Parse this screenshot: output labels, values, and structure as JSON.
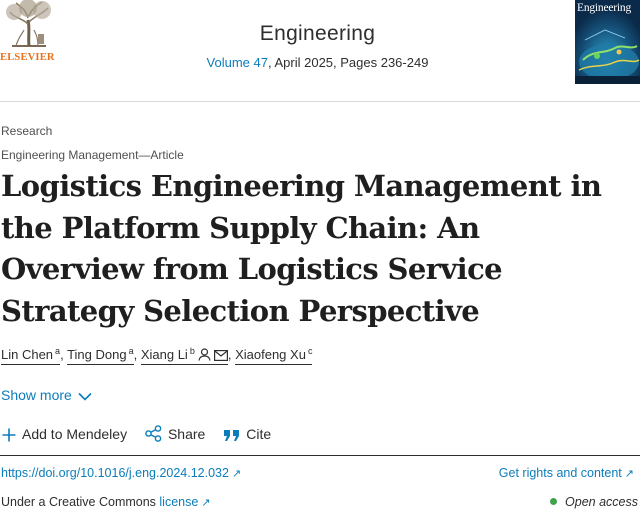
{
  "publisher": {
    "name": "ELSEVIER"
  },
  "journal": {
    "title": "Engineering",
    "volume_link": "Volume 47",
    "issue_info": ", April 2025, Pages 236-249",
    "cover_title": "Engineering"
  },
  "article": {
    "type": "Research",
    "section": "Engineering Management—Article",
    "title": "Logistics Engineering Management in the Platform Supply Chain: An Overview from Logistics Service Strategy Selection Perspective"
  },
  "authors": [
    {
      "name": "Lin Chen",
      "affil": "a"
    },
    {
      "name": "Ting Dong",
      "affil": "a"
    },
    {
      "name": "Xiang Li",
      "affil": "b"
    },
    {
      "name": "Xiaofeng Xu",
      "affil": "c"
    }
  ],
  "separators": {
    "comma": ","
  },
  "show_more": "Show more",
  "actions": {
    "mendeley": "Add to Mendeley",
    "share": "Share",
    "cite": "Cite"
  },
  "links": {
    "doi": "https://doi.org/10.1016/j.eng.2024.12.032",
    "rights": "Get rights and content",
    "license_prefix": "Under a Creative Commons ",
    "license_link": "license",
    "open_access": "Open access",
    "arrow": "↗"
  },
  "colors": {
    "link": "#0c7dbb",
    "brand": "#e9711c",
    "open_access": "#3fa34d"
  },
  "icons": [
    "elsevier-tree-logo",
    "person-icon",
    "envelope-icon",
    "chevron-down-icon",
    "plus-icon",
    "share-icon",
    "quote-icon",
    "external-arrow-icon",
    "open-access-dot"
  ]
}
